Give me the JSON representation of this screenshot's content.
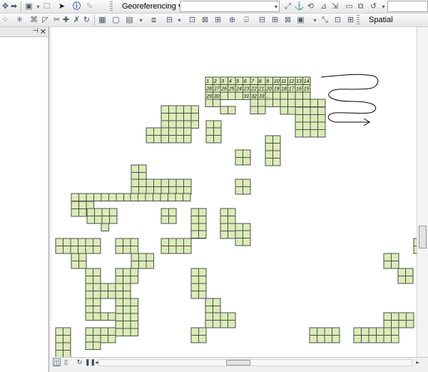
{
  "toolbar1": {
    "georef_label": "Georeferencing",
    "georef_arrow": "▾",
    "layer_combo_value": "",
    "right_input_value": ""
  },
  "toolbar2": {
    "spatial_adjustment_label": "Spatial Adjustment",
    "spatial_adjustment_arrow": "▾"
  },
  "left_panel": {
    "pin_glyph": "⊣",
    "close_glyph": "✕"
  },
  "grid_labels": {
    "row1": [
      "1",
      "2",
      "3",
      "4",
      "5",
      "6",
      "7",
      "8",
      "9",
      "10",
      "11",
      "12",
      "13",
      "14"
    ],
    "row2": [
      "28",
      "27",
      "26",
      "25",
      "24",
      "23",
      "22",
      "21",
      "20",
      "19",
      "18",
      "17",
      "16",
      "15"
    ],
    "row3": [
      "29",
      "30",
      "",
      "",
      "",
      "31",
      "32",
      "33",
      "...",
      "",
      ""
    ]
  },
  "icons": {
    "tb1": [
      "pan-icon",
      "forward-icon",
      "select-elements-icon",
      "identify-icon",
      "pencil-icon",
      "georef-dropdown-icon"
    ],
    "tb2": [
      "add-control-points-icon",
      "spatial-adjust-icon"
    ]
  },
  "colors": {
    "cell_fill": "#dcecb8",
    "cell_stroke": "#4c4c4c",
    "arrow_stroke": "#000000"
  }
}
